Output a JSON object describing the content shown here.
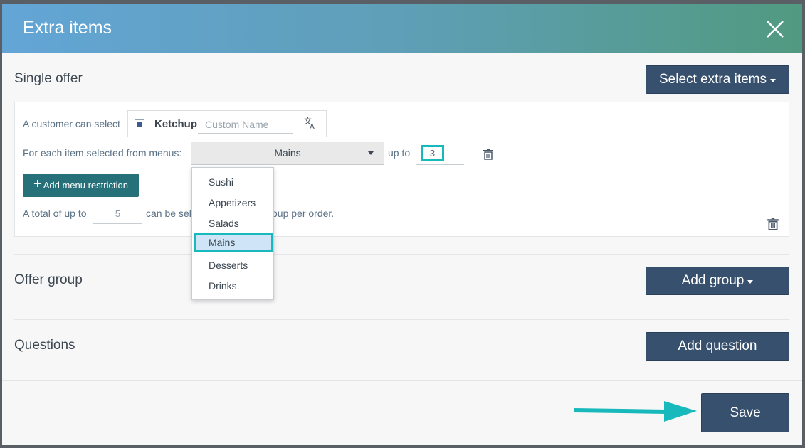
{
  "modal": {
    "title": "Extra items",
    "close_icon": "close-icon"
  },
  "single_offer": {
    "title": "Single offer",
    "select_button": "Select extra items",
    "customer_label": "A customer can select",
    "item": {
      "name": "Ketchup",
      "checked": true,
      "custom_name_placeholder": "Custom Name",
      "translate_icon": "translate-icon"
    },
    "menu_restriction": {
      "label": "For each item selected from menus:",
      "selected_menu": "Mains",
      "up_to_label": "up to",
      "quantity": "3"
    },
    "add_restriction_button": "Add menu restriction",
    "total_prefix": "A total of up to",
    "total_value": "5",
    "total_suffix_a": "can be sel",
    "total_suffix_b": "oup per order."
  },
  "menu_dropdown": {
    "options": [
      "Sushi",
      "Appetizers",
      "Salads",
      "Mains",
      "Desserts",
      "Drinks"
    ],
    "selected": "Mains"
  },
  "offer_group": {
    "title": "Offer group",
    "button": "Add group"
  },
  "questions": {
    "title": "Questions",
    "button": "Add question"
  },
  "footer": {
    "save_button": "Save"
  },
  "colors": {
    "header_start": "#63a5d6",
    "header_end": "#519a80",
    "primary": "#37506e",
    "teal_button": "#26707a",
    "highlight": "#17b9bd"
  }
}
